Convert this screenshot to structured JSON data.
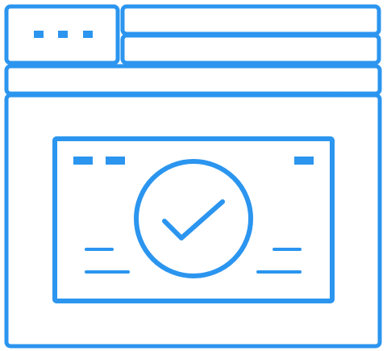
{
  "colors": {
    "stroke": "#2b95ef",
    "background": "#ffffff"
  },
  "icon": {
    "name": "browser-window-verified-card-icon",
    "parts": [
      "window-controls-icon",
      "address-bar",
      "toolbar-bar",
      "card",
      "checkmark-icon"
    ]
  }
}
